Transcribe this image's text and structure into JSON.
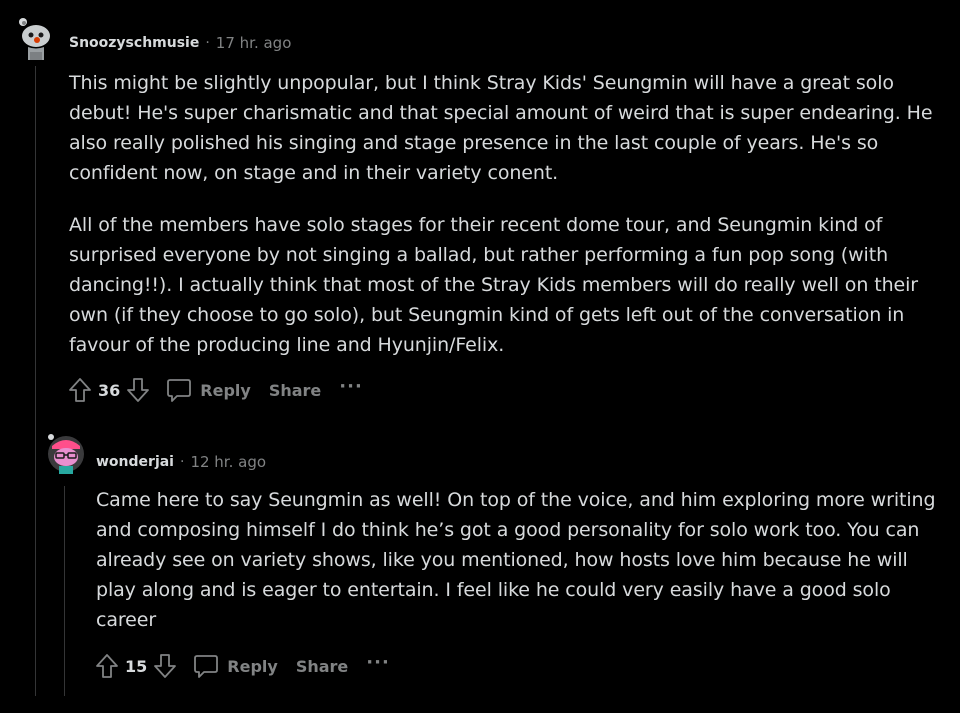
{
  "colors": {
    "background": "#000000",
    "text": "#d7dadc",
    "muted": "#818384",
    "thread_line": "#343536"
  },
  "comments": [
    {
      "username": "Snoozyschmusie",
      "separator": "·",
      "time": "17 hr. ago",
      "avatar_icon": "snoo-avatar-gray-icon",
      "paragraphs": [
        "This might be slightly unpopular, but I think Stray Kids' Seungmin will have a great solo debut! He's super charismatic and that special amount of weird that is super endearing. He also really polished his singing and stage presence in the last couple of years. He's so confident now, on stage and in their variety conent.",
        "All of the members have solo stages for their recent dome tour, and Seungmin kind of surprised everyone by not singing a ballad, but rather performing a fun pop song (with dancing!!). I actually think that most of the Stray Kids members will do really well on their own (if they choose to go solo), but Seungmin kind of gets left out of the conversation in favour of the producing line and Hyunjin/Felix."
      ],
      "score": "36",
      "reply_label": "Reply",
      "share_label": "Share",
      "more_label": "···"
    },
    {
      "username": "wonderjai",
      "separator": "·",
      "time": "12 hr. ago",
      "avatar_icon": "snoo-avatar-pink-icon",
      "paragraphs": [
        "Came here to say Seungmin as well! On top of the voice, and him exploring more writing and composing himself I do think he’s got a good personality for solo work too. You can already see on variety shows, like you mentioned, how hosts love him because he will play along and is eager to entertain. I feel like he could very easily have a good solo career"
      ],
      "score": "15",
      "reply_label": "Reply",
      "share_label": "Share",
      "more_label": "···"
    }
  ]
}
